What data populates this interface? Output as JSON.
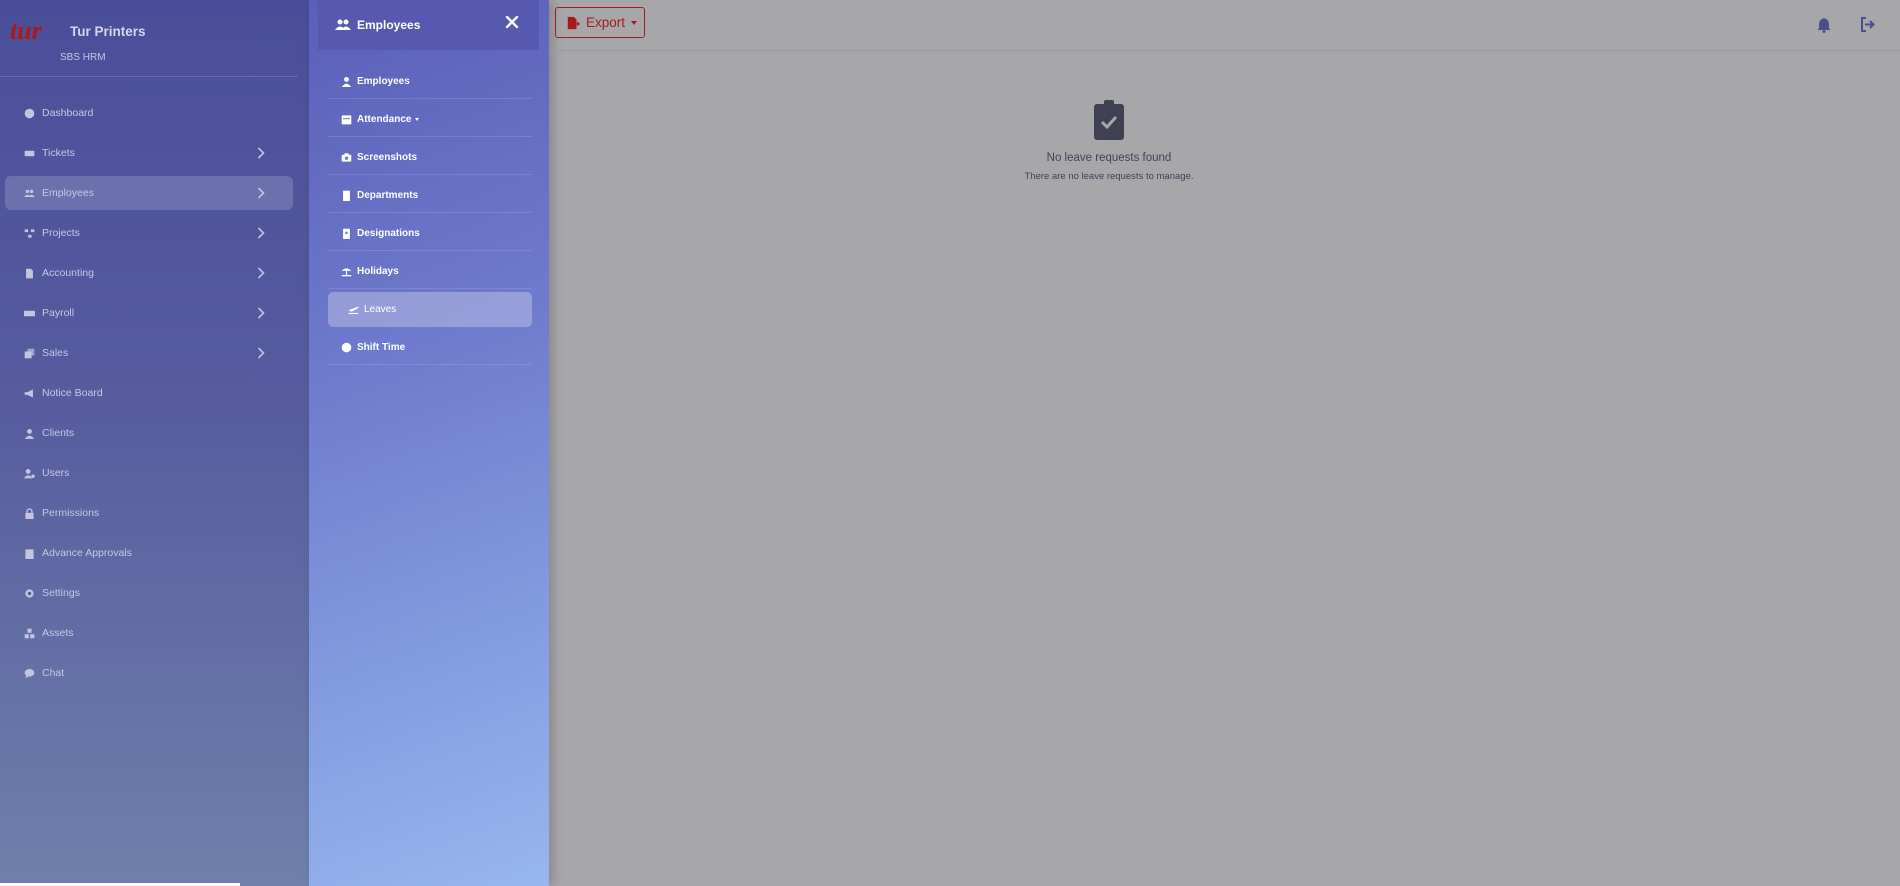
{
  "brand": {
    "name": "Tur Printers",
    "subtitle": "SBS HRM",
    "logo_text": "tur"
  },
  "sidebar": {
    "items": [
      {
        "label": "Dashboard",
        "icon": "dashboard-icon",
        "chevron": false,
        "active": false
      },
      {
        "label": "Tickets",
        "icon": "ticket-icon",
        "chevron": true,
        "active": false
      },
      {
        "label": "Employees",
        "icon": "users-icon",
        "chevron": true,
        "active": true
      },
      {
        "label": "Projects",
        "icon": "project-diagram-icon",
        "chevron": true,
        "active": false
      },
      {
        "label": "Accounting",
        "icon": "file-invoice-icon",
        "chevron": true,
        "active": false
      },
      {
        "label": "Payroll",
        "icon": "money-bill-icon",
        "chevron": true,
        "active": false
      },
      {
        "label": "Sales",
        "icon": "sales-icon",
        "chevron": true,
        "active": false
      },
      {
        "label": "Notice Board",
        "icon": "bullhorn-icon",
        "chevron": false,
        "active": false
      },
      {
        "label": "Clients",
        "icon": "user-icon",
        "chevron": false,
        "active": false
      },
      {
        "label": "Users",
        "icon": "user-cog-icon",
        "chevron": false,
        "active": false
      },
      {
        "label": "Permissions",
        "icon": "lock-icon",
        "chevron": false,
        "active": false
      },
      {
        "label": "Advance Approvals",
        "icon": "clipboard-icon",
        "chevron": false,
        "active": false
      },
      {
        "label": "Settings",
        "icon": "gear-icon",
        "chevron": false,
        "active": false
      },
      {
        "label": "Assets",
        "icon": "boxes-icon",
        "chevron": false,
        "active": false
      },
      {
        "label": "Chat",
        "icon": "comment-icon",
        "chevron": false,
        "active": false
      }
    ]
  },
  "submenu": {
    "title": "Employees",
    "items": [
      {
        "label": "Employees",
        "icon": "user-icon",
        "active": false,
        "dropdown": false
      },
      {
        "label": "Attendance",
        "icon": "calendar-icon",
        "active": false,
        "dropdown": true
      },
      {
        "label": "Screenshots",
        "icon": "camera-icon",
        "active": false,
        "dropdown": false
      },
      {
        "label": "Departments",
        "icon": "building-icon",
        "active": false,
        "dropdown": false
      },
      {
        "label": "Designations",
        "icon": "id-badge-icon",
        "active": false,
        "dropdown": false
      },
      {
        "label": "Holidays",
        "icon": "umbrella-beach-icon",
        "active": false,
        "dropdown": false
      },
      {
        "label": "Leaves",
        "icon": "plane-departure-icon",
        "active": true,
        "dropdown": false
      },
      {
        "label": "Shift Time",
        "icon": "clock-icon",
        "active": false,
        "dropdown": false
      }
    ]
  },
  "topbar": {
    "export_label": "Export"
  },
  "empty_state": {
    "title": "No leave requests found",
    "subtitle": "There are no leave requests to manage."
  },
  "colors": {
    "sidebar_top": "#4a4e9a",
    "submenu_bottom": "#98b6ee",
    "export_red": "#a31c1c",
    "content_bg": "#a7a7a9"
  }
}
